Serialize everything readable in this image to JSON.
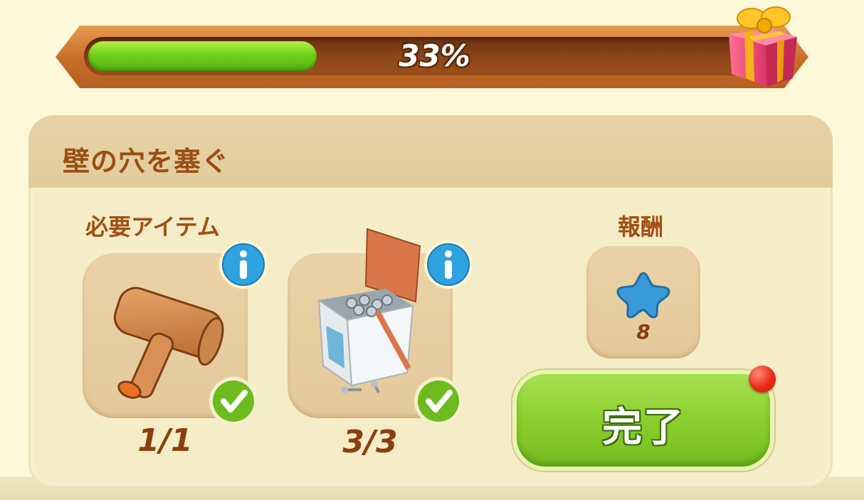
{
  "progress": {
    "percent_label": "33%",
    "fill_fraction": 0.33
  },
  "task": {
    "title": "壁の穴を塞ぐ",
    "required_label": "必要アイテム",
    "reward_label": "報酬",
    "items": [
      {
        "icon": "wooden-mallet-icon",
        "count": "1/1",
        "complete": true
      },
      {
        "icon": "nails-box-icon",
        "count": "3/3",
        "complete": true
      }
    ],
    "reward": {
      "icon": "blue-star-icon",
      "value": "8"
    },
    "complete_button_label": "完了"
  },
  "colors": {
    "progress_fill": "#6fd21c",
    "accent_brown": "#9a4f14",
    "button_green": "#8ccf2e",
    "notification_red": "#ea2a15"
  }
}
